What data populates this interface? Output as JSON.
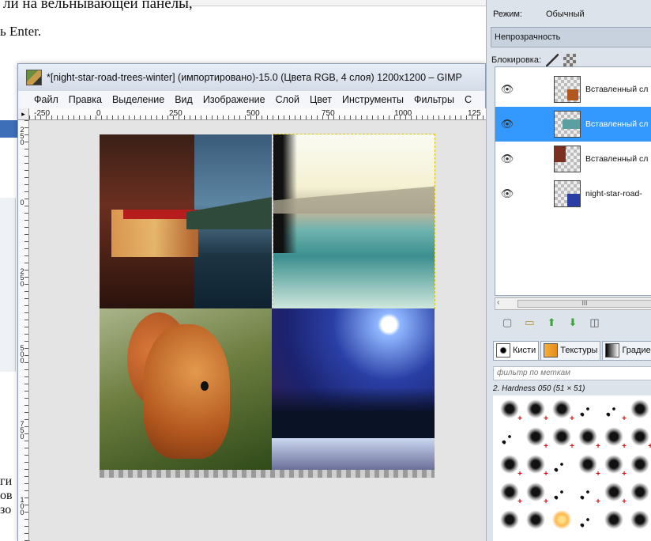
{
  "document": {
    "line1": "ли на вельнывающей панелы,",
    "line2": "ь Enter.",
    "left_bits": [
      "ги",
      "ов",
      "зо"
    ]
  },
  "gimp": {
    "title": "*[night-star-road-trees-winter] (импортировано)-15.0 (Цвета RGB, 4 слоя) 1200x1200 – GIMP",
    "menu": [
      "Файл",
      "Правка",
      "Выделение",
      "Вид",
      "Изображение",
      "Слой",
      "Цвет",
      "Инструменты",
      "Фильтры",
      "С"
    ],
    "ruler_h": [
      "-250",
      "0",
      "250",
      "500",
      "750",
      "1000",
      "125"
    ],
    "ruler_v": [
      "2\n5\n0",
      "0",
      "2\n5\n0",
      "5\n0\n0",
      "7\n5\n0",
      "1\n0\n0"
    ],
    "ruler_corner": "▸"
  },
  "right_panel": {
    "mode_label": "Режим:",
    "mode_value": "Обычный",
    "opacity_label": "Непрозрачность",
    "lock_label": "Блокировка:",
    "layers": [
      {
        "name": "Вставленный сл",
        "selected": false
      },
      {
        "name": "Вставленный сл",
        "selected": true
      },
      {
        "name": "Вставленный сл",
        "selected": false
      },
      {
        "name": "night-star-road-",
        "selected": false
      }
    ],
    "scroll_thumb": "III",
    "tabs": [
      "Кисти",
      "Текстуры",
      "Градиен"
    ],
    "filter_placeholder": "фильтр по меткам",
    "brush_name": "2. Hardness 050 (51 × 51)"
  },
  "colors": {
    "selection_blue": "#3399ff",
    "panel_bg": "#dde3ea",
    "selection_marquee": "#d8c400"
  }
}
